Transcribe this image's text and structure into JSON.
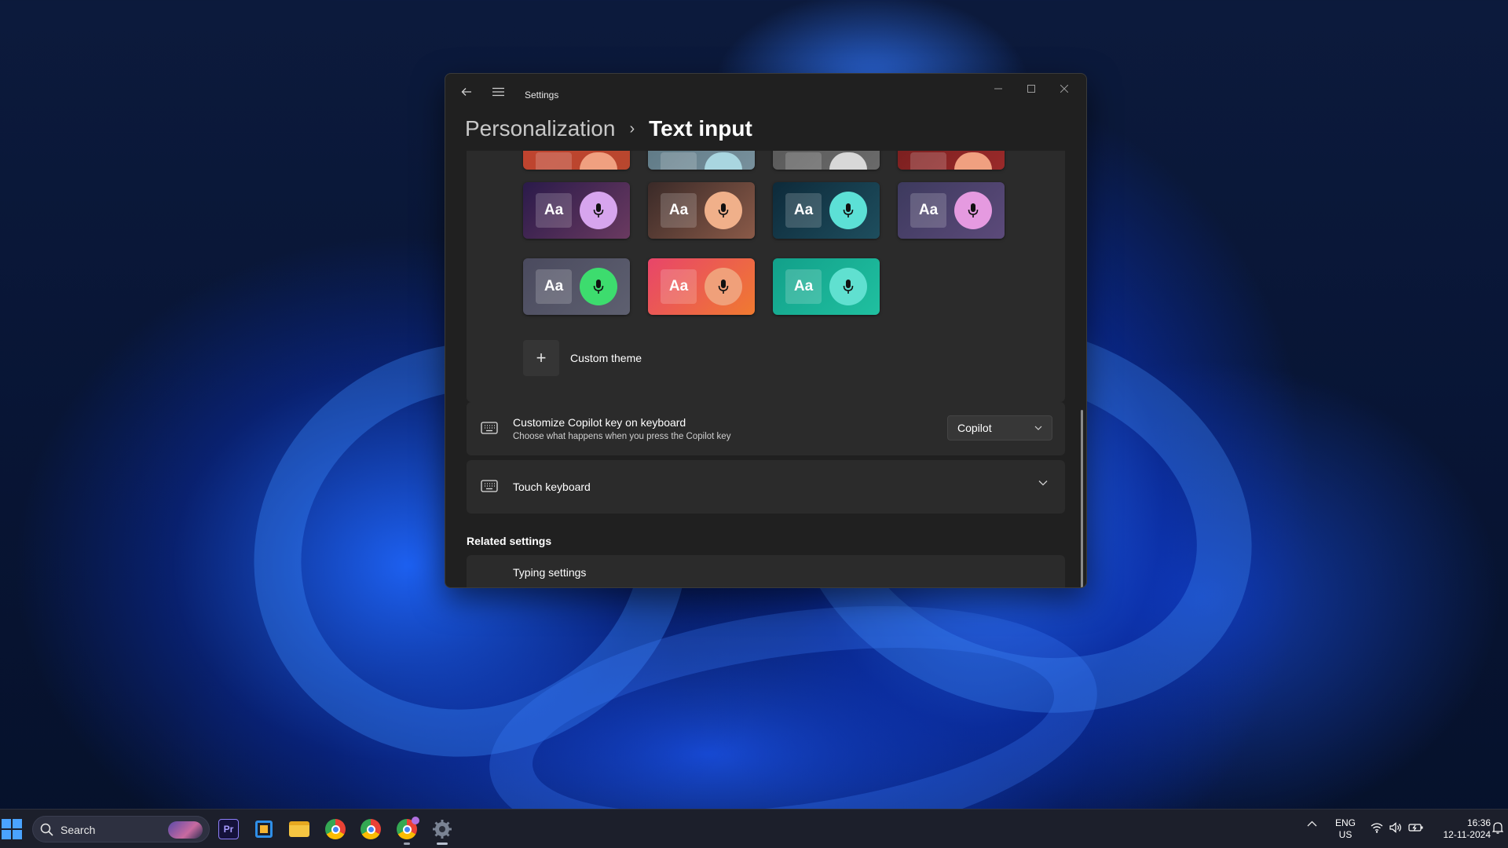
{
  "window": {
    "app_title": "Settings",
    "breadcrumb_parent": "Personalization",
    "breadcrumb_separator": "›",
    "breadcrumb_current": "Text input"
  },
  "themes": {
    "partial_row": [
      {
        "bg": [
          "#c0432f",
          "#b8472e"
        ],
        "mic": "#f0a080"
      },
      {
        "bg": [
          "#5f7a86",
          "#78909c"
        ],
        "mic": "#a9d6e0"
      },
      {
        "bg": [
          "#5a5a5a",
          "#6a6a6a"
        ],
        "mic": "#d8d8d8"
      },
      {
        "bg": [
          "#7a1f1f",
          "#9a2a2a"
        ],
        "mic": "#f0a080"
      }
    ],
    "tiles": [
      {
        "label": "Aa",
        "bg": [
          "#2a1a4a",
          "#6a3a60"
        ],
        "mic": "#d7a5ee"
      },
      {
        "label": "Aa",
        "bg": [
          "#3a2a28",
          "#8a5a48"
        ],
        "mic": "#f0b08a"
      },
      {
        "label": "Aa",
        "bg": [
          "#0d2a3a",
          "#1e4e5e"
        ],
        "mic": "#5ce0d6"
      },
      {
        "label": "Aa",
        "bg": [
          "#3d3a5e",
          "#5c4a7a"
        ],
        "mic": "#e59ae0"
      },
      {
        "label": "Aa",
        "bg": [
          "#4a4a5e",
          "#5e6070"
        ],
        "mic": "#3ddc6e"
      },
      {
        "label": "Aa",
        "bg": [
          "#e8456a",
          "#f07a30"
        ],
        "mic": "#f0a07a"
      },
      {
        "label": "Aa",
        "bg": [
          "#12a08a",
          "#20c0a0"
        ],
        "mic": "#60e0d0"
      }
    ],
    "custom_theme_label": "Custom theme"
  },
  "copilot_key": {
    "title": "Customize Copilot key on keyboard",
    "subtitle": "Choose what happens when you press the Copilot key",
    "dropdown_value": "Copilot",
    "icon": "keyboard-icon"
  },
  "touch_keyboard": {
    "title": "Touch keyboard",
    "icon": "keyboard-icon"
  },
  "related": {
    "heading": "Related settings",
    "first_item": "Typing settings"
  },
  "taskbar": {
    "search_label": "Search",
    "apps": [
      "adobe-premiere-pro",
      "app-tile",
      "file-explorer",
      "chrome",
      "chrome",
      "chrome-profile",
      "settings"
    ],
    "lang_primary": "ENG",
    "lang_secondary": "US",
    "time": "16:36",
    "date": "12-11-2024"
  },
  "colors": {
    "accent": "#4aa3ff",
    "window_bg": "#202020",
    "card_bg": "#2b2b2b"
  }
}
